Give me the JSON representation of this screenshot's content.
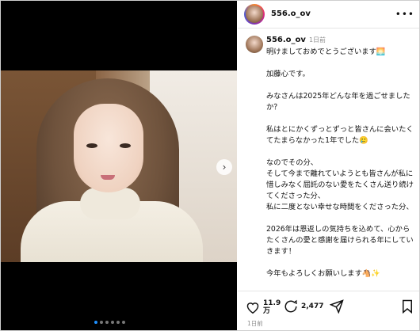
{
  "post": {
    "username": "556.o_ov",
    "caption_user": "556.o_ov",
    "caption_time": "1日前",
    "caption": [
      "明けましておめでとうございます🌅",
      "加藤心です。",
      "みなさんは2025年どんな年を過ごせましたか？",
      "私はとにかくずっとずっと皆さんに会いたくてたまらなかった1年でした🥲",
      "なのでその分、\nそして今まで離れていようとも皆さんが私に惜しみなく屈託のない愛をたくさん送り続けてくださった分、\n私に二度とない幸せな時間をくださった分、",
      "2026年は恩返しの気持ちを込めて、心からたくさんの愛と感謝を届けられる年にしていきます！",
      "今年もよろしくお願いします🐴✨"
    ],
    "likes": "11.9\n万",
    "comments": "2,477",
    "timestamp": "1日前",
    "carousel_index": 1,
    "carousel_total": 6
  },
  "icons": {
    "more": "more-horizontal-icon",
    "next": "chevron-right-icon",
    "like": "heart-icon",
    "comment": "comment-icon",
    "share": "share-icon",
    "save": "bookmark-icon"
  },
  "colors": {
    "accent": "#1e90ff",
    "muted": "#8e8e8e"
  }
}
